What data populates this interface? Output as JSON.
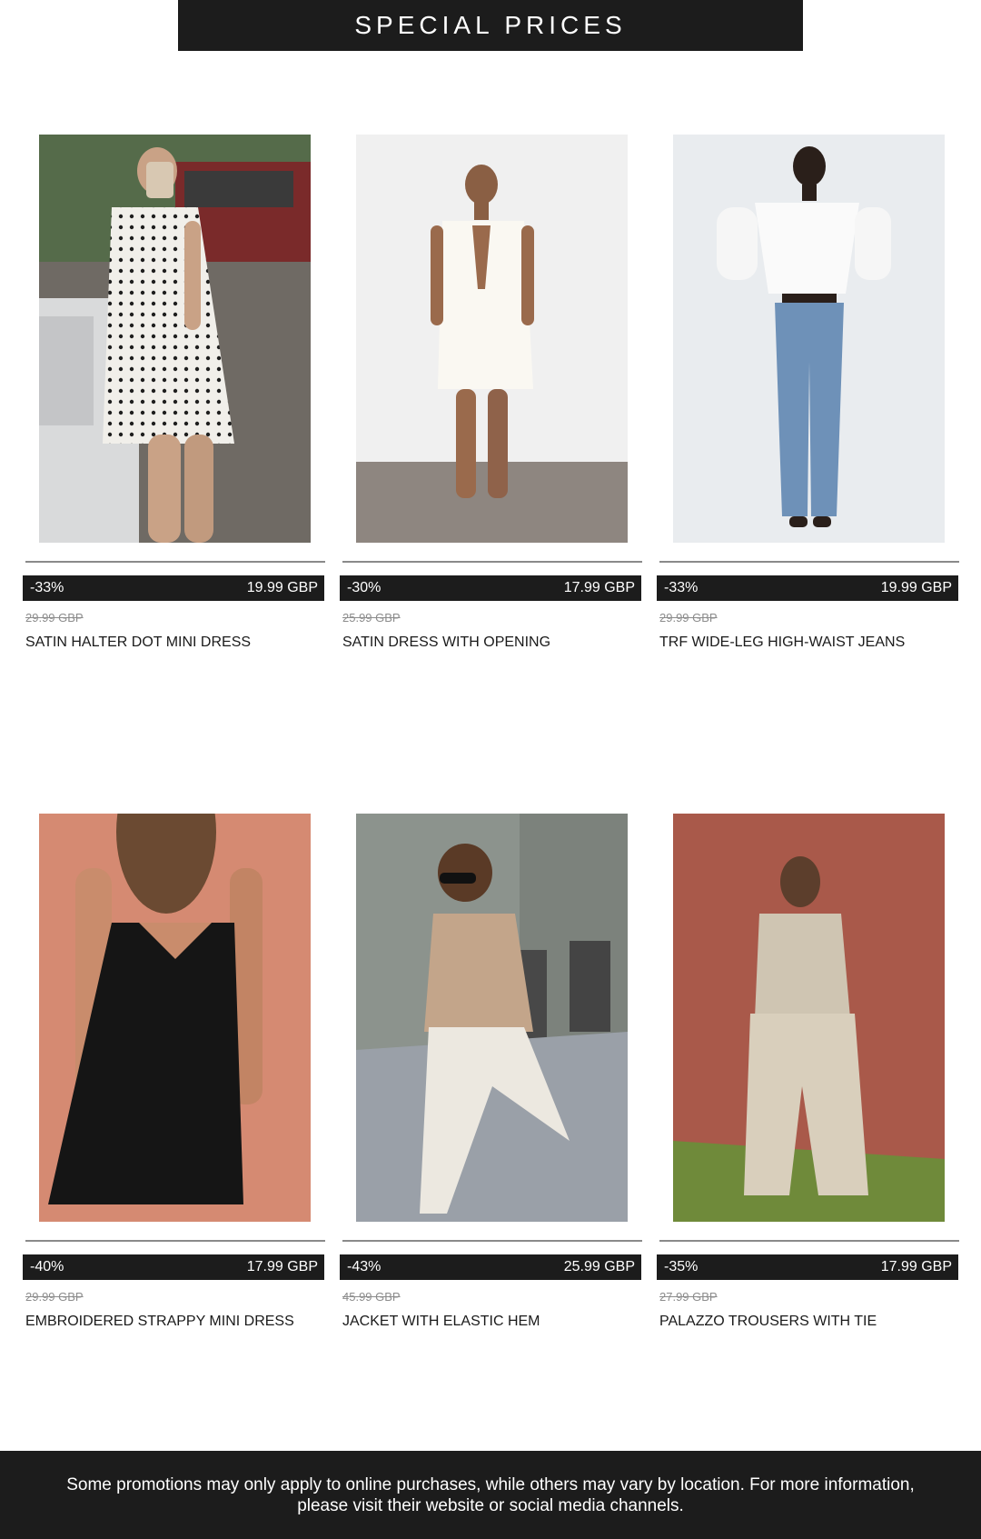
{
  "header": {
    "title": "SPECIAL PRICES"
  },
  "products": [
    {
      "discount": "-33%",
      "price": "19.99 GBP",
      "old_price": "29.99 GBP",
      "name": "SATIN HALTER DOT MINI DRESS",
      "image_icon": "polka-dot-halter-dress-photo"
    },
    {
      "discount": "-30%",
      "price": "17.99 GBP",
      "old_price": "25.99 GBP",
      "name": "SATIN DRESS WITH OPENING",
      "image_icon": "white-satin-dress-photo"
    },
    {
      "discount": "-33%",
      "price": "19.99 GBP",
      "old_price": "29.99 GBP",
      "name": "TRF WIDE-LEG HIGH-WAIST JEANS",
      "image_icon": "wide-leg-jeans-photo"
    },
    {
      "discount": "-40%",
      "price": "17.99 GBP",
      "old_price": "29.99 GBP",
      "name": "EMBROIDERED STRAPPY MINI DRESS",
      "image_icon": "black-strappy-dress-photo"
    },
    {
      "discount": "-43%",
      "price": "25.99 GBP",
      "old_price": "45.99 GBP",
      "name": "JACKET WITH ELASTIC HEM",
      "image_icon": "beige-jacket-photo"
    },
    {
      "discount": "-35%",
      "price": "17.99 GBP",
      "old_price": "27.99 GBP",
      "name": "PALAZZO TROUSERS WITH TIE",
      "image_icon": "palazzo-trousers-photo"
    }
  ],
  "footer": {
    "notice": "Some promotions may only apply to online purchases, while others may vary by location. For more information, please visit their website or social media channels."
  },
  "colors": {
    "banner": "#1c1c1c",
    "banner_text": "#ffffff",
    "old_price": "#8c8c8c",
    "divider": "#8a8a8a"
  }
}
